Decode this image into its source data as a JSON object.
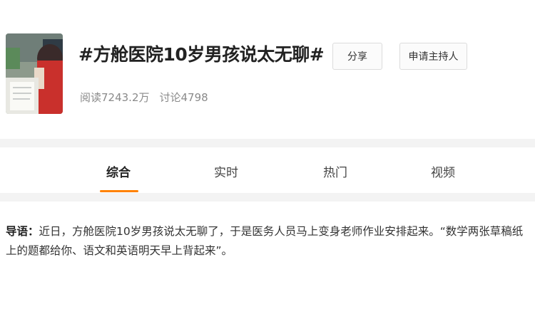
{
  "topic": {
    "title": "#方舱医院10岁男孩说太无聊#",
    "reads": "阅读7243.2万",
    "discussions": "讨论4798"
  },
  "buttons": {
    "share": "分享",
    "apply_host": "申请主持人"
  },
  "tabs": [
    {
      "label": "综合",
      "active": true
    },
    {
      "label": "实时",
      "active": false
    },
    {
      "label": "热门",
      "active": false
    },
    {
      "label": "视频",
      "active": false
    }
  ],
  "intro": {
    "label": "导语：",
    "text": "近日，方舱医院10岁男孩说太无聊了，于是医务人员马上变身老师作业安排起来。“数学两张草稿纸上的题都给你、语文和英语明天早上背起来”。"
  },
  "colors": {
    "accent": "#ff8200",
    "separator": "#f3f3f3",
    "muted_text": "#8a8a8a"
  }
}
